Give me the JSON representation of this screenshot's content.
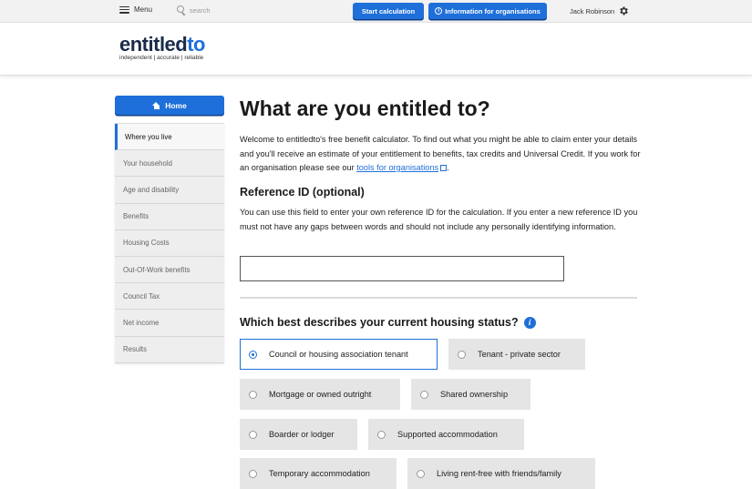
{
  "topbar": {
    "menu_label": "Menu",
    "search_placeholder": "search",
    "start_button": "Start calculation",
    "info_button": "Information for organisations",
    "user_name": "Jack Robinson"
  },
  "header": {
    "logo_main": "entitled",
    "logo_accent": "to",
    "tagline": "independent | accurate | reliable"
  },
  "sidebar": {
    "home_label": "Home",
    "items": [
      {
        "label": "Where you live"
      },
      {
        "label": "Your household"
      },
      {
        "label": "Age and disability"
      },
      {
        "label": "Benefits"
      },
      {
        "label": "Housing Costs"
      },
      {
        "label": "Out-Of-Work benefits"
      },
      {
        "label": "Council Tax"
      },
      {
        "label": "Net income"
      },
      {
        "label": "Results"
      }
    ]
  },
  "main": {
    "title": "What are you entitled to?",
    "intro_text": "Welcome to entitledto's free benefit calculator. To find out what you might be able to claim enter your details and you'll receive an estimate of your entitlement to benefits, tax credits and Universal Credit. If you work for an organisation please see our ",
    "intro_link": "tools for organisations",
    "intro_end": ".",
    "reference": {
      "title": "Reference ID (optional)",
      "text": "You can use this field to enter your own reference ID for the calculation. If you enter a new reference ID you must not have any gaps between words and should not include any personally identifying information.",
      "value": ""
    },
    "housing": {
      "question": "Which best describes your current housing status?",
      "help_glyph": "i",
      "options": [
        {
          "label": "Council or housing association tenant",
          "selected": true
        },
        {
          "label": "Tenant - private sector",
          "selected": false
        },
        {
          "label": "Mortgage or owned outright",
          "selected": false
        },
        {
          "label": "Shared ownership",
          "selected": false
        },
        {
          "label": "Boarder or lodger",
          "selected": false
        },
        {
          "label": "Supported accommodation",
          "selected": false
        },
        {
          "label": "Temporary accommodation",
          "selected": false
        },
        {
          "label": "Living rent-free with friends/family",
          "selected": false
        }
      ]
    }
  },
  "colors": {
    "accent": "#1e6fd9",
    "logo_dark": "#1a2b4a",
    "option_bg": "#e5e5e5",
    "nav_bg": "#eeeeee"
  }
}
